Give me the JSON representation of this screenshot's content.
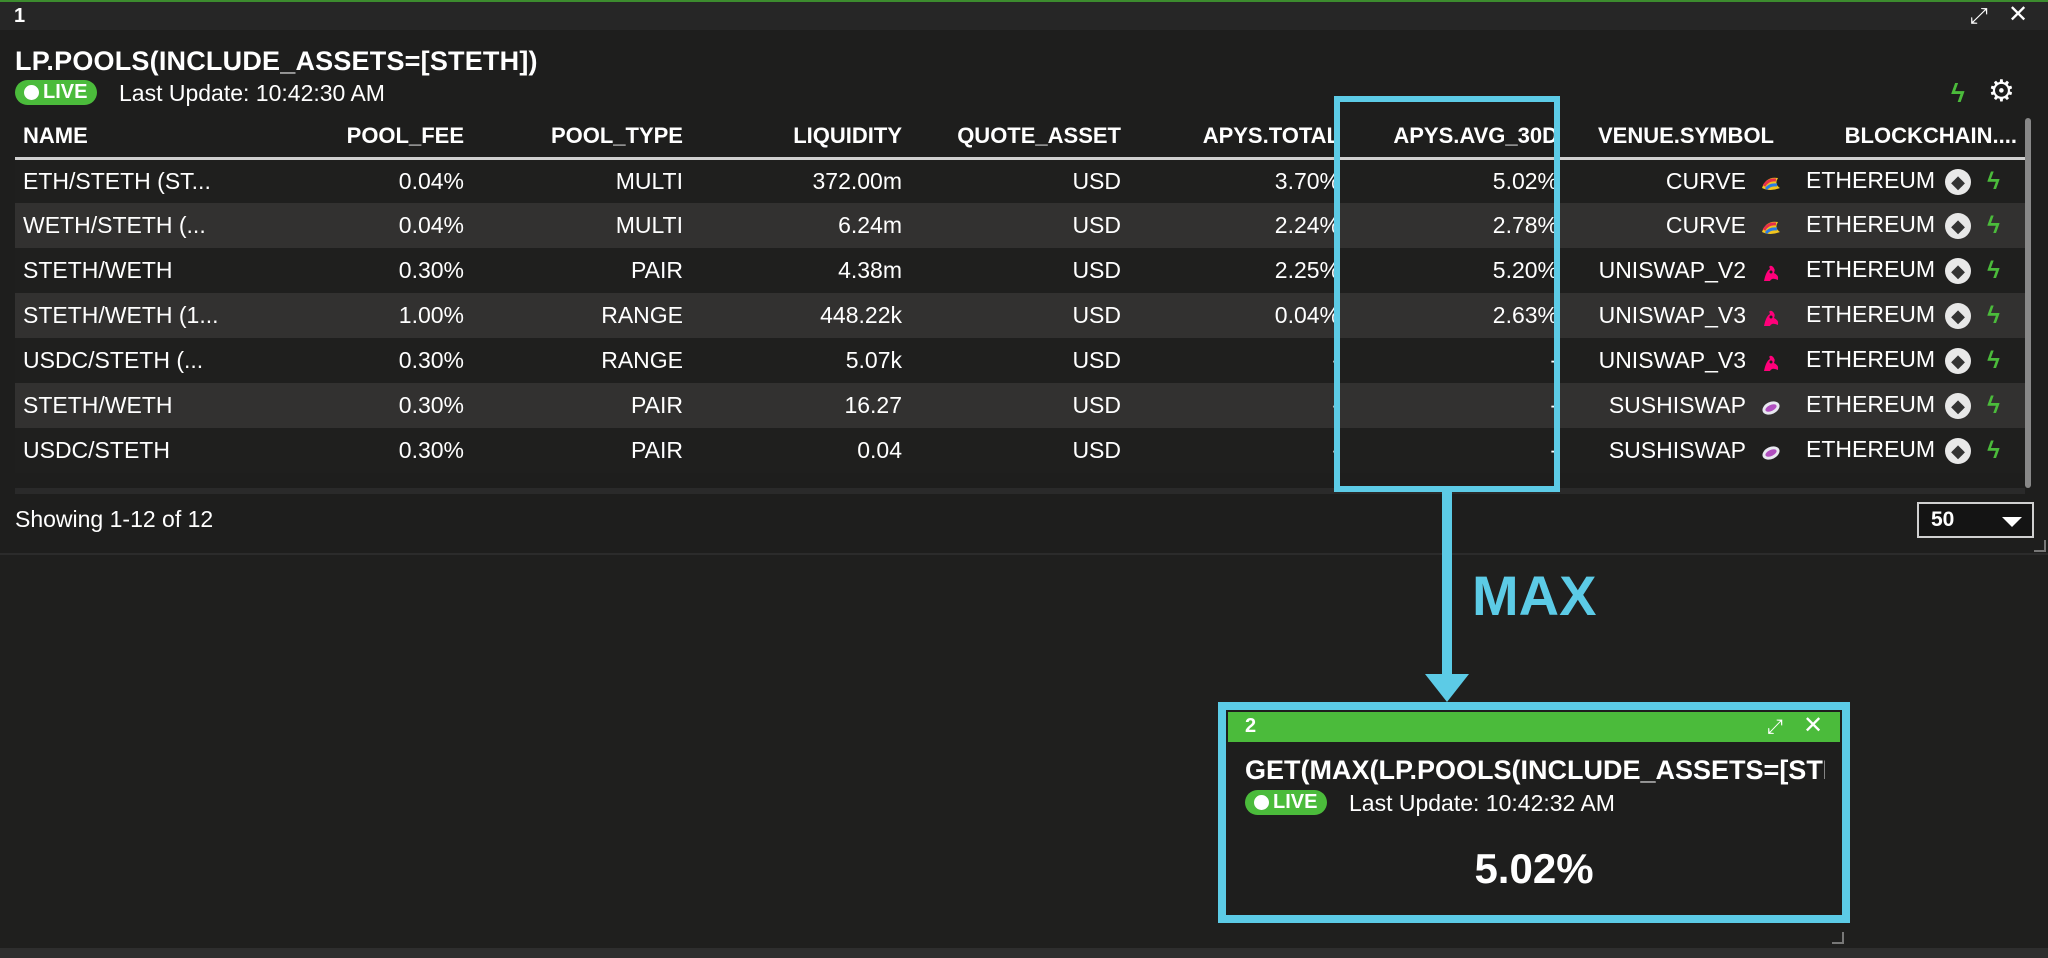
{
  "window1": {
    "number": "1",
    "title": "LP.POOLS(INCLUDE_ASSETS=[STETH])",
    "live_label": "LIVE",
    "last_update": "Last Update: 10:42:30 AM",
    "columns": [
      "NAME",
      "POOL_FEE",
      "POOL_TYPE",
      "LIQUIDITY",
      "QUOTE_ASSET",
      "APYS.TOTAL",
      "APYS.AVG_30D",
      "VENUE.SYMBOL",
      "BLOCKCHAIN...."
    ],
    "rows": [
      {
        "name": "ETH/STETH (ST...",
        "pool_fee": "0.04%",
        "pool_type": "MULTI",
        "liquidity": "372.00m",
        "quote_asset": "USD",
        "apys_total": "3.70%",
        "apys_avg_30d": "5.02%",
        "venue": "CURVE",
        "venue_icon": "curve-logo-icon",
        "blockchain": "ETHEREUM"
      },
      {
        "name": "WETH/STETH (...",
        "pool_fee": "0.04%",
        "pool_type": "MULTI",
        "liquidity": "6.24m",
        "quote_asset": "USD",
        "apys_total": "2.24%",
        "apys_avg_30d": "2.78%",
        "venue": "CURVE",
        "venue_icon": "curve-logo-icon",
        "blockchain": "ETHEREUM"
      },
      {
        "name": "STETH/WETH",
        "pool_fee": "0.30%",
        "pool_type": "PAIR",
        "liquidity": "4.38m",
        "quote_asset": "USD",
        "apys_total": "2.25%",
        "apys_avg_30d": "5.20%",
        "venue": "UNISWAP_V2",
        "venue_icon": "uniswap-logo-icon",
        "blockchain": "ETHEREUM"
      },
      {
        "name": "STETH/WETH (1...",
        "pool_fee": "1.00%",
        "pool_type": "RANGE",
        "liquidity": "448.22k",
        "quote_asset": "USD",
        "apys_total": "0.04%",
        "apys_avg_30d": "2.63%",
        "venue": "UNISWAP_V3",
        "venue_icon": "uniswap-logo-icon",
        "blockchain": "ETHEREUM"
      },
      {
        "name": "USDC/STETH (...",
        "pool_fee": "0.30%",
        "pool_type": "RANGE",
        "liquidity": "5.07k",
        "quote_asset": "USD",
        "apys_total": "-",
        "apys_avg_30d": "-",
        "venue": "UNISWAP_V3",
        "venue_icon": "uniswap-logo-icon",
        "blockchain": "ETHEREUM"
      },
      {
        "name": "STETH/WETH",
        "pool_fee": "0.30%",
        "pool_type": "PAIR",
        "liquidity": "16.27",
        "quote_asset": "USD",
        "apys_total": "-",
        "apys_avg_30d": "-",
        "venue": "SUSHISWAP",
        "venue_icon": "sushiswap-logo-icon",
        "blockchain": "ETHEREUM"
      },
      {
        "name": "USDC/STETH",
        "pool_fee": "0.30%",
        "pool_type": "PAIR",
        "liquidity": "0.04",
        "quote_asset": "USD",
        "apys_total": "-",
        "apys_avg_30d": "-",
        "venue": "SUSHISWAP",
        "venue_icon": "sushiswap-logo-icon",
        "blockchain": "ETHEREUM"
      }
    ],
    "showing": "Showing 1-12 of 12",
    "page_size": "50"
  },
  "annotation": {
    "label": "MAX",
    "color": "#5ccbe6"
  },
  "window2": {
    "number": "2",
    "title": "GET(MAX(LP.POOLS(INCLUDE_ASSETS=[STETH])",
    "live_label": "LIVE",
    "last_update": "Last Update: 10:42:32 AM",
    "value": "5.02%"
  },
  "colors": {
    "accent_green": "#4bbb3b",
    "highlight_cyan": "#5ccbe6",
    "background": "#1f1f1e",
    "row_alt": "#323130"
  }
}
